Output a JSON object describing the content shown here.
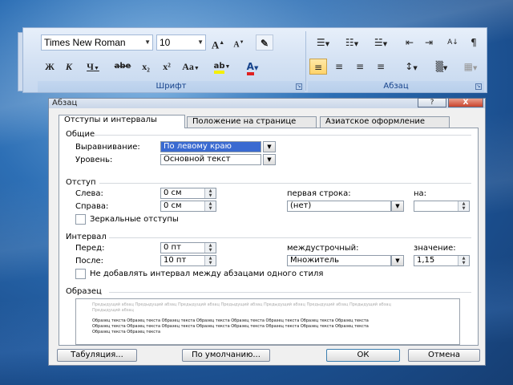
{
  "ribbon": {
    "font_name": "Times New Roman",
    "font_size": "10",
    "grow_font": "A",
    "shrink_font": "A",
    "clear_format": "✎",
    "bold": "Ж",
    "italic": "К",
    "underline": "Ч",
    "strike": "abe",
    "subscript": "x₂",
    "superscript": "x²",
    "change_case": "Aa",
    "highlight": "ab",
    "font_color": "A",
    "group_font_label": "Шрифт",
    "group_para_label": "Абзац",
    "bullets": "☰",
    "numbering": "☷",
    "multilevel": "☱",
    "decrease_indent": "⇤",
    "increase_indent": "⇥",
    "sort": "A↓",
    "show_marks": "¶",
    "align_left": "≡",
    "align_center": "≡",
    "align_right": "≡",
    "justify": "≡",
    "line_spacing": "↕",
    "shading": "▒",
    "borders": "▦"
  },
  "dialog": {
    "title": "Абзац",
    "help": "?",
    "close": "X",
    "tabs": [
      {
        "label": "Отступы и интервалы"
      },
      {
        "label": "Положение на странице"
      },
      {
        "label": "Азиатское оформление"
      }
    ],
    "general": {
      "title": "Общие",
      "alignment_label": "Выравнивание:",
      "alignment_value": "По левому краю",
      "level_label": "Уровень:",
      "level_value": "Основной текст"
    },
    "indent": {
      "title": "Отступ",
      "left_label": "Слева:",
      "left_value": "0 см",
      "right_label": "Справа:",
      "right_value": "0 см",
      "first_line_label": "первая строка:",
      "first_line_value": "(нет)",
      "by_label": "на:",
      "by_value": "",
      "mirror_label": "Зеркальные отступы"
    },
    "spacing": {
      "title": "Интервал",
      "before_label": "Перед:",
      "before_value": "0 пт",
      "after_label": "После:",
      "after_value": "10 пт",
      "line_label": "междустрочный:",
      "line_value": "Множитель",
      "at_label": "значение:",
      "at_value": "1,15",
      "no_space_label": "Не добавлять интервал между абзацами одного стиля"
    },
    "preview": {
      "title": "Образец",
      "prev_text": "Предыдущий абзац Предыдущий абзац Предыдущий абзац Предыдущий абзац Предыдущий абзац Предыдущий абзац Предыдущий абзац",
      "prev_text_end": "Предыдущий абзац",
      "sample_text": "Образец текста Образец текста Образец текста Образец текста Образец текста Образец текста Образец текста Образец текста",
      "sample_text_end": "Образец текста Образец текста"
    },
    "buttons": {
      "tabs": "Табуляция...",
      "default": "По умолчанию...",
      "ok": "ОК",
      "cancel": "Отмена"
    }
  },
  "colors": {
    "accent_blue": "#15428b",
    "selection": "#3a6ad1",
    "font_color_bar": "#e02020",
    "highlight_bar": "#f5f000"
  }
}
